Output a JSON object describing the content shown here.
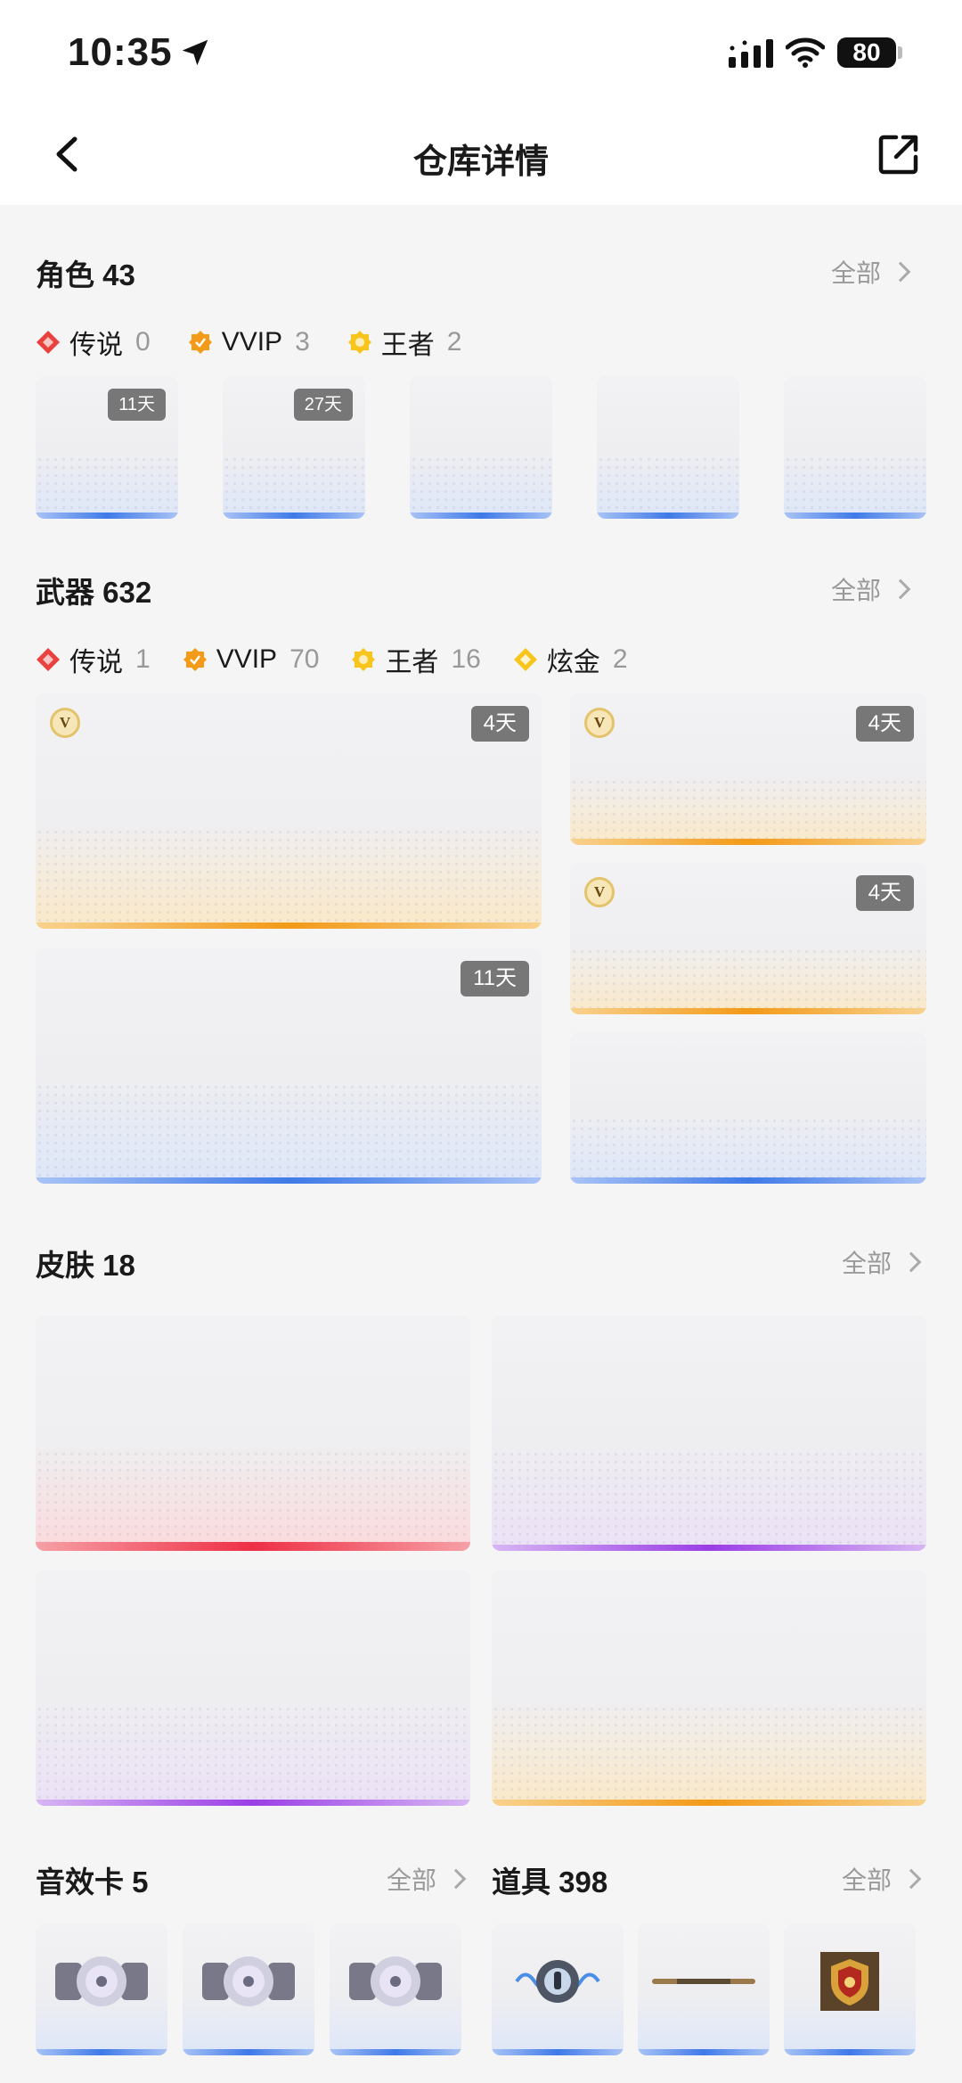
{
  "status_bar": {
    "time": "10:35",
    "battery": "80"
  },
  "nav": {
    "title": "仓库详情"
  },
  "roles": {
    "title": "角色 43",
    "more": "全部",
    "rarities": [
      {
        "label": "传说",
        "count": "0",
        "color": "#e8413e"
      },
      {
        "label": "VVIP",
        "count": "3",
        "color": "#f39a18"
      },
      {
        "label": "王者",
        "count": "2",
        "color": "#f7c51e"
      }
    ],
    "cards": [
      {
        "badge": "11天"
      },
      {
        "badge": "27天"
      },
      {
        "badge": ""
      },
      {
        "badge": ""
      },
      {
        "badge": ""
      }
    ]
  },
  "weapons": {
    "title": "武器 632",
    "more": "全部",
    "rarities": [
      {
        "label": "传说",
        "count": "1",
        "color": "#e8413e"
      },
      {
        "label": "VVIP",
        "count": "70",
        "color": "#f39a18"
      },
      {
        "label": "王者",
        "count": "16",
        "color": "#f7c51e"
      },
      {
        "label": "炫金",
        "count": "2",
        "color": "#f7c51e"
      }
    ],
    "cards": [
      {
        "badge": "4天",
        "vip": "V"
      },
      {
        "badge": "4天",
        "vip": "V"
      },
      {
        "badge": "4天",
        "vip": "V"
      },
      {
        "badge": "11天"
      },
      {
        "badge": ""
      }
    ]
  },
  "skins": {
    "title": "皮肤 18",
    "more": "全部"
  },
  "sound_cards": {
    "title": "音效卡 5",
    "more": "全部"
  },
  "props": {
    "title": "道具 398",
    "more": "全部"
  },
  "colors": {
    "blue": "#3f7ae8",
    "gold": "#f39a18",
    "purple": "#9b3ee6",
    "red": "#ee2f45"
  }
}
